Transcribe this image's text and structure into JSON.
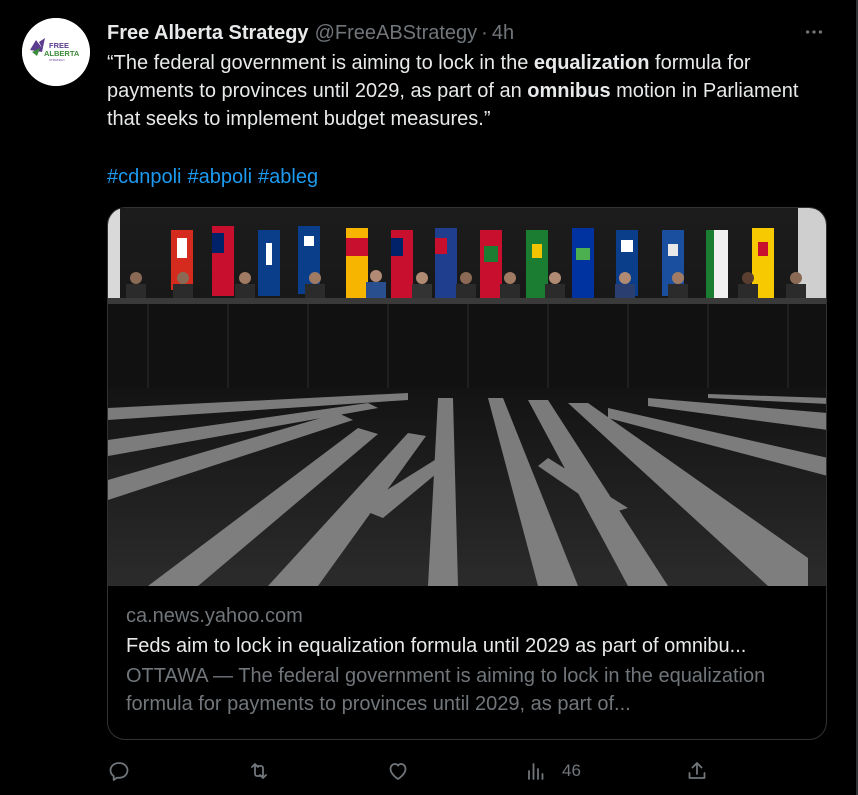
{
  "author": {
    "display_name": "Free Alberta Strategy",
    "handle": "@FreeABStrategy",
    "separator": "·",
    "time": "4h",
    "avatar_text_line1": "FREE",
    "avatar_text_line2": "ALBERTA",
    "avatar_text_line3": "STRATEGY"
  },
  "tweet": {
    "seg1": "“The federal government is aiming to lock in the ",
    "bold1": "equalization",
    "seg2": " formula for payments to provinces until 2029, as part of an ",
    "bold2": "omnibus",
    "seg3": " motion in Parliament that seeks to implement budget measures.”",
    "hashtags": [
      "#cdnpoli",
      "#abpoli",
      "#ableg"
    ]
  },
  "card": {
    "domain": "ca.news.yahoo.com",
    "title": "Feds aim to lock in equalization formula until 2029 as part of omnibu...",
    "description": "OTTAWA — The federal government is aiming to lock in the equalization formula for payments to provinces until 2029, as part of...",
    "image_subject": "photo-premiers-table-flags"
  },
  "actions": {
    "reply_icon": "reply-icon",
    "retweet_icon": "retweet-icon",
    "like_icon": "heart-icon",
    "views_icon": "views-icon",
    "views_count": "46",
    "share_icon": "share-icon"
  },
  "colors": {
    "background": "#000000",
    "text": "#e7e9ea",
    "muted": "#71767b",
    "link": "#1d9bf0",
    "border": "#2f3336",
    "avatar_green": "#3c8b3a",
    "avatar_purple": "#5b3c8e"
  },
  "more_icon": "more-icon"
}
